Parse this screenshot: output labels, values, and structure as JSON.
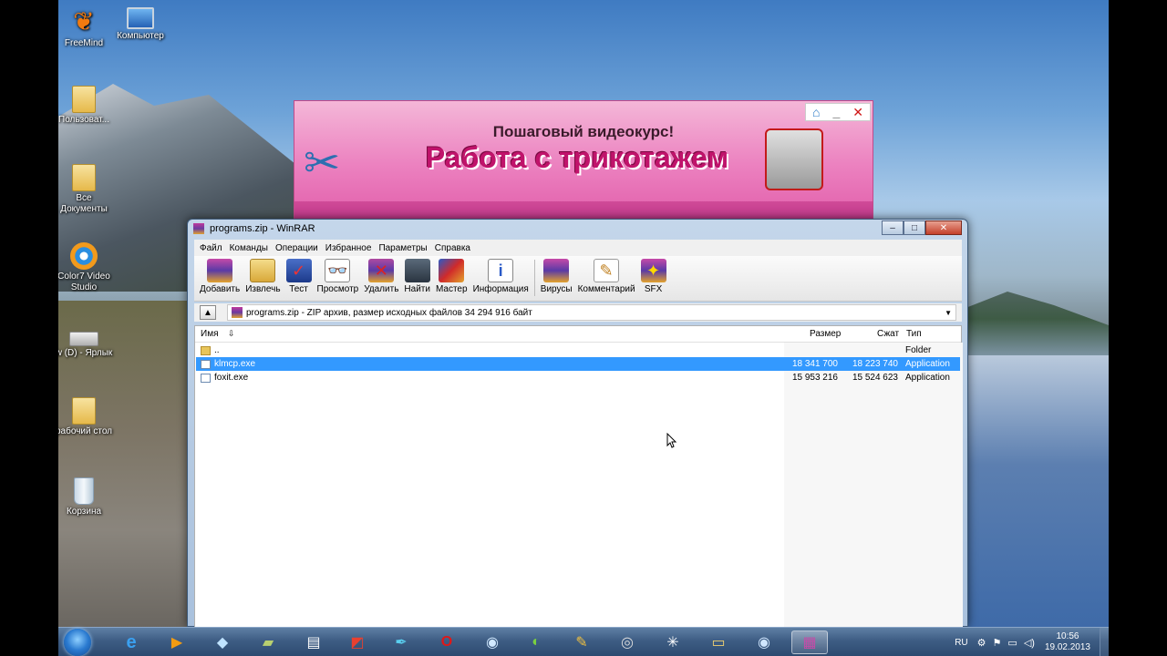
{
  "desktop": {
    "icons": [
      {
        "label": "FreeMind",
        "icon": "butterfly-icon"
      },
      {
        "label": "Компьютер",
        "icon": "computer-icon"
      },
      {
        "label": "Пользоват...",
        "icon": "user-folder-icon"
      },
      {
        "label": "Все Документы",
        "icon": "folder-icon"
      },
      {
        "label": "Color7 Video Studio",
        "icon": "video-studio-icon"
      },
      {
        "label": "w (D) - Ярлык",
        "icon": "drive-icon"
      },
      {
        "label": "рабочий стол",
        "icon": "folder-icon"
      },
      {
        "label": "Корзина",
        "icon": "recycle-bin-icon"
      }
    ]
  },
  "ad": {
    "subtitle": "Пошаговый видеокурс!",
    "title": "Работа с трикотажем"
  },
  "window": {
    "title": "programs.zip - WinRAR",
    "controls": {
      "minimize": "–",
      "maximize": "□",
      "close": "✕"
    },
    "menu": [
      "Файл",
      "Команды",
      "Операции",
      "Избранное",
      "Параметры",
      "Справка"
    ],
    "toolbar": [
      {
        "label": "Добавить",
        "icon": "add-icon"
      },
      {
        "label": "Извлечь",
        "icon": "extract-icon"
      },
      {
        "label": "Тест",
        "icon": "test-icon"
      },
      {
        "label": "Просмотр",
        "icon": "view-icon"
      },
      {
        "label": "Удалить",
        "icon": "delete-icon"
      },
      {
        "label": "Найти",
        "icon": "find-icon"
      },
      {
        "label": "Мастер",
        "icon": "wizard-icon"
      },
      {
        "label": "Информация",
        "icon": "info-icon"
      },
      {
        "label": "Вирусы",
        "icon": "virus-icon"
      },
      {
        "label": "Комментарий",
        "icon": "comment-icon"
      },
      {
        "label": "SFX",
        "icon": "sfx-icon"
      }
    ],
    "path": "programs.zip - ZIP архив, размер исходных файлов 34 294 916 байт",
    "columns": {
      "name": "Имя",
      "size": "Размер",
      "packed": "Сжат",
      "type": "Тип"
    },
    "files": [
      {
        "name": "..",
        "size": "",
        "packed": "",
        "type": "Folder",
        "selected": false,
        "kind": "folder"
      },
      {
        "name": "klmcp.exe",
        "size": "18 341 700",
        "packed": "18 223 740",
        "type": "Application",
        "selected": true,
        "kind": "app"
      },
      {
        "name": "foxit.exe",
        "size": "15 953 216",
        "packed": "15 524 623",
        "type": "Application",
        "selected": false,
        "kind": "app"
      }
    ]
  },
  "taskbar": {
    "lang": "RU",
    "time": "10:56",
    "date": "19.02.2013"
  }
}
